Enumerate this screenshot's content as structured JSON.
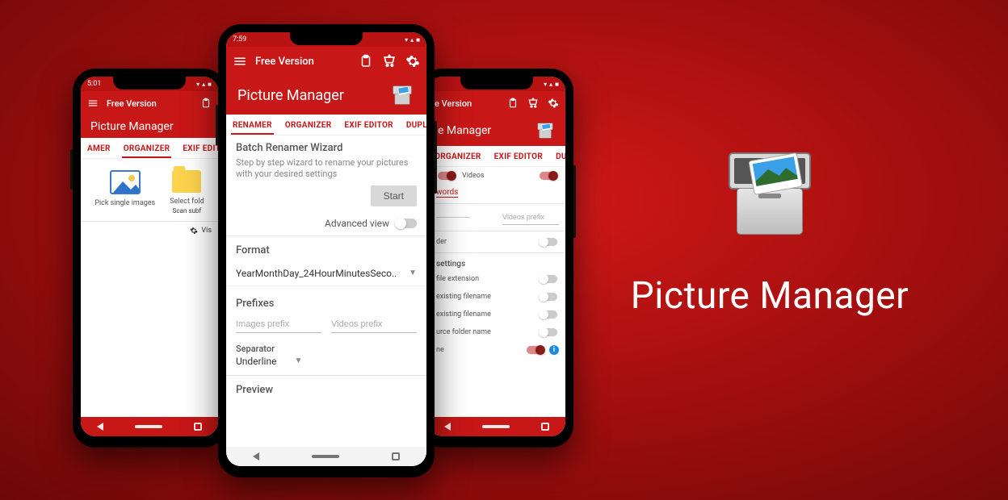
{
  "hero": {
    "title": "Picture Manager"
  },
  "status": {
    "time_left": "5:01",
    "time_center": "7:59"
  },
  "toolbar": {
    "title": "Free Version"
  },
  "titlebar": {
    "app": "Picture Manager"
  },
  "tabs": {
    "center": [
      "RENAMER",
      "ORGANIZER",
      "EXIF EDITOR",
      "DUPLICA"
    ],
    "left": [
      "AMER",
      "ORGANIZER",
      "EXIF EDITOR"
    ],
    "right": [
      "ORGANIZER",
      "EXIF EDITOR",
      "DUPLICA"
    ]
  },
  "center": {
    "wizard_title": "Batch Renamer Wizard",
    "wizard_desc": "Step by step wizard to rename your pictures with your desired settings",
    "start": "Start",
    "advanced_view": "Advanced view",
    "format_label": "Format",
    "format_value": "YearMonthDay_24HourMinutesSeco..",
    "prefixes_label": "Prefixes",
    "images_prefix_ph": "Images prefix",
    "videos_prefix_ph": "Videos prefix",
    "separator_label": "Separator",
    "separator_value": "Underline",
    "preview_label": "Preview"
  },
  "left": {
    "pick_single": "Pick single images",
    "select_folder": "Select fold",
    "scan_sub": "Scan subf",
    "visible": "Vis"
  },
  "right": {
    "version": "e Version",
    "title_fragment": "e Manager",
    "videos": "Videos",
    "words": "words",
    "videos_prefix_ph": "Videos prefix",
    "subfolder": "der",
    "settings": "settings",
    "rows": [
      "file extension",
      "existing filename",
      "existing filename",
      "urce folder name",
      "ne"
    ]
  }
}
